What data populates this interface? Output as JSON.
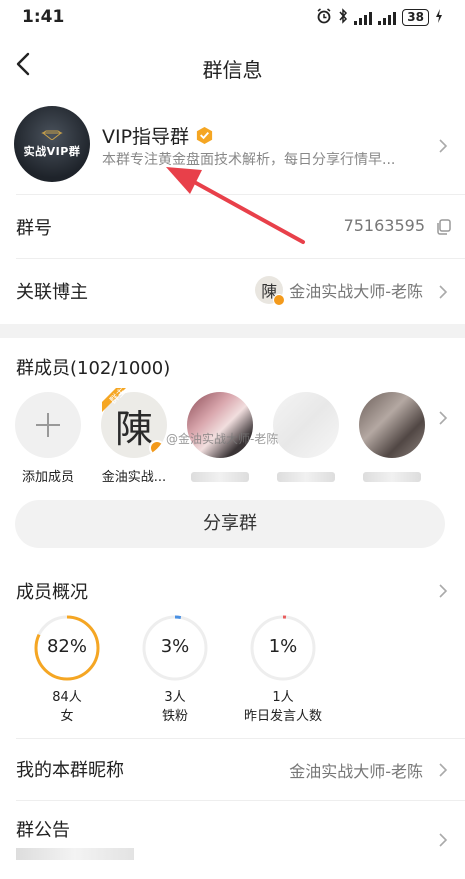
{
  "status_bar": {
    "time": "1:41",
    "battery": "38"
  },
  "nav": {
    "title": "群信息",
    "back_icon": "back-chevron-icon"
  },
  "group": {
    "avatar_text": "实战VIP群",
    "name": "VIP指导群",
    "description": "本群专注黄金盘面技术解析，每日分享行情早..."
  },
  "group_number": {
    "label": "群号",
    "value": "75163595"
  },
  "linked_blogger": {
    "label": "关联博主",
    "avatar_char": "陳",
    "name": "金油实战大师-老陈"
  },
  "members": {
    "title": "群成员(102/1000)",
    "add_label": "添加成员",
    "owner_tag": "群主",
    "owner_avatar_char": "陳",
    "owner_name": "金油实战..."
  },
  "watermark": "@金油实战大师-老陈",
  "share_button": "分享群",
  "overview": {
    "title": "成员概况",
    "stats": [
      {
        "percent": "82%",
        "count": "84人",
        "label": "女",
        "fraction": 0.82,
        "color": "#f5a623"
      },
      {
        "percent": "3%",
        "count": "3人",
        "label": "铁粉",
        "fraction": 0.03,
        "color": "#4a90e2"
      },
      {
        "percent": "1%",
        "count": "1人",
        "label": "昨日发言人数",
        "fraction": 0.01,
        "color": "#e85d5d"
      }
    ]
  },
  "nickname": {
    "label": "我的本群昵称",
    "value": "金油实战大师-老陈"
  },
  "announcement": {
    "label": "群公告"
  },
  "colors": {
    "accent": "#f39a1c",
    "annotation_arrow": "#e8404a"
  }
}
